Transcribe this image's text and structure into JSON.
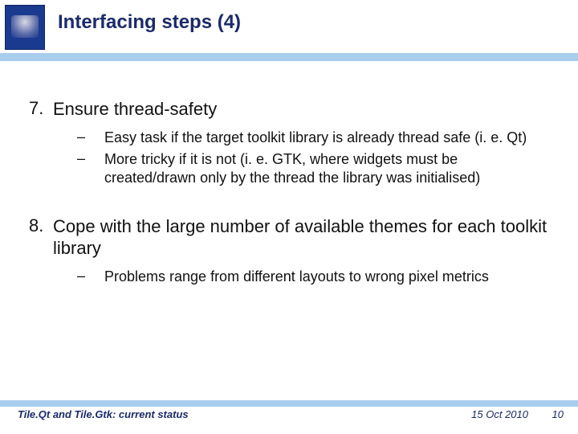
{
  "header": {
    "title": "Interfacing steps (4)",
    "logo_caption": ""
  },
  "items": [
    {
      "number": "7.",
      "text": "Ensure thread-safety",
      "subs": [
        "Easy task if the target toolkit library is already thread safe (i. e. Qt)",
        "More tricky if it is not (i. e. GTK, where widgets must be created/drawn only by the thread the library was initialised)"
      ]
    },
    {
      "number": "8.",
      "text": "Cope with the large number of available themes for each toolkit library",
      "subs": [
        "Problems range from different layouts to wrong pixel metrics"
      ]
    }
  ],
  "footer": {
    "left": "Tile.Qt and Tile.Gtk: current status",
    "date": "15 Oct 2010",
    "page": "10"
  }
}
